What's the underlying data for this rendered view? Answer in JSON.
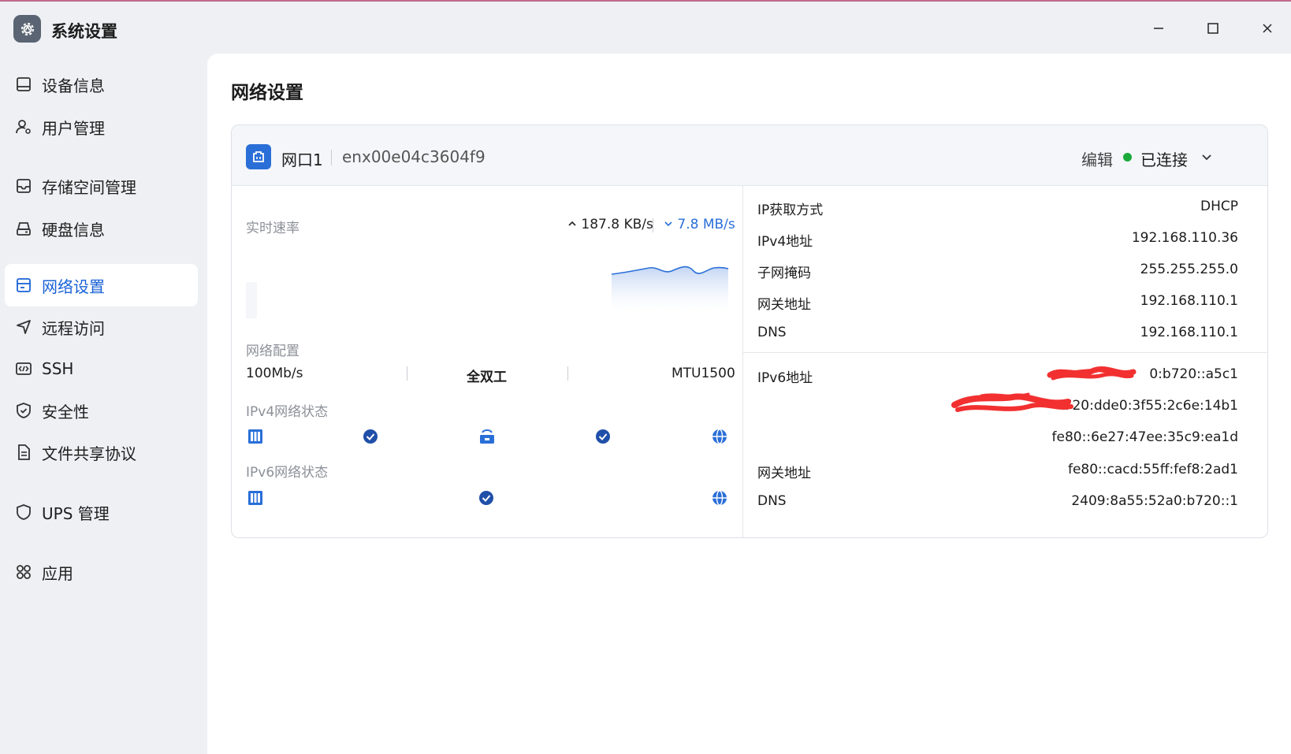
{
  "window": {
    "title": "系统设置",
    "icon": "gear-icon"
  },
  "sidebar": {
    "items": [
      {
        "label": "设备信息",
        "icon": "device-icon"
      },
      {
        "label": "用户管理",
        "icon": "user-gear-icon"
      },
      {
        "label": "存储空间管理",
        "icon": "storage-icon"
      },
      {
        "label": "硬盘信息",
        "icon": "disk-icon"
      },
      {
        "label": "网络设置",
        "icon": "network-icon",
        "active": true
      },
      {
        "label": "远程访问",
        "icon": "send-icon"
      },
      {
        "label": "SSH",
        "icon": "code-icon"
      },
      {
        "label": "安全性",
        "icon": "shield-check-icon"
      },
      {
        "label": "文件共享协议",
        "icon": "file-icon"
      },
      {
        "label": "UPS 管理",
        "icon": "shield-icon"
      },
      {
        "label": "应用",
        "icon": "apps-icon"
      }
    ]
  },
  "main": {
    "title": "网络设置",
    "card": {
      "port_name": "网口1",
      "interface": "enx00e04c3604f9",
      "edit_label": "编辑",
      "status": "已连接",
      "status_color": "#1aaa3a",
      "realtime_label": "实时速率",
      "upload": "187.8 KB/s",
      "download": "7.8 MB/s",
      "config_label": "网络配置",
      "speed": "100Mb/s",
      "duplex": "全双工",
      "mtu": "MTU1500",
      "ipv4_status_label": "IPv4网络状态",
      "ipv6_status_label": "IPv6网络状态",
      "ipv4": [
        {
          "key": "IP获取方式",
          "value": "DHCP"
        },
        {
          "key": "IPv4地址",
          "value": "192.168.110.36"
        },
        {
          "key": "子网掩码",
          "value": "255.255.255.0"
        },
        {
          "key": "网关地址",
          "value": "192.168.110.1"
        },
        {
          "key": "DNS",
          "value": "192.168.110.1"
        }
      ],
      "ipv6": {
        "address_label": "IPv6地址",
        "addresses": [
          "0:b720::a5c1",
          "720:dde0:3f55:2c6e:14b1",
          "fe80::6e27:47ee:35c9:ea1d"
        ],
        "gateway_label": "网关地址",
        "gateway": "fe80::cacd:55ff:fef8:2ad1",
        "dns_label": "DNS",
        "dns": "2409:8a55:52a0:b720::1"
      }
    }
  },
  "accent_color": "#1a62d6"
}
